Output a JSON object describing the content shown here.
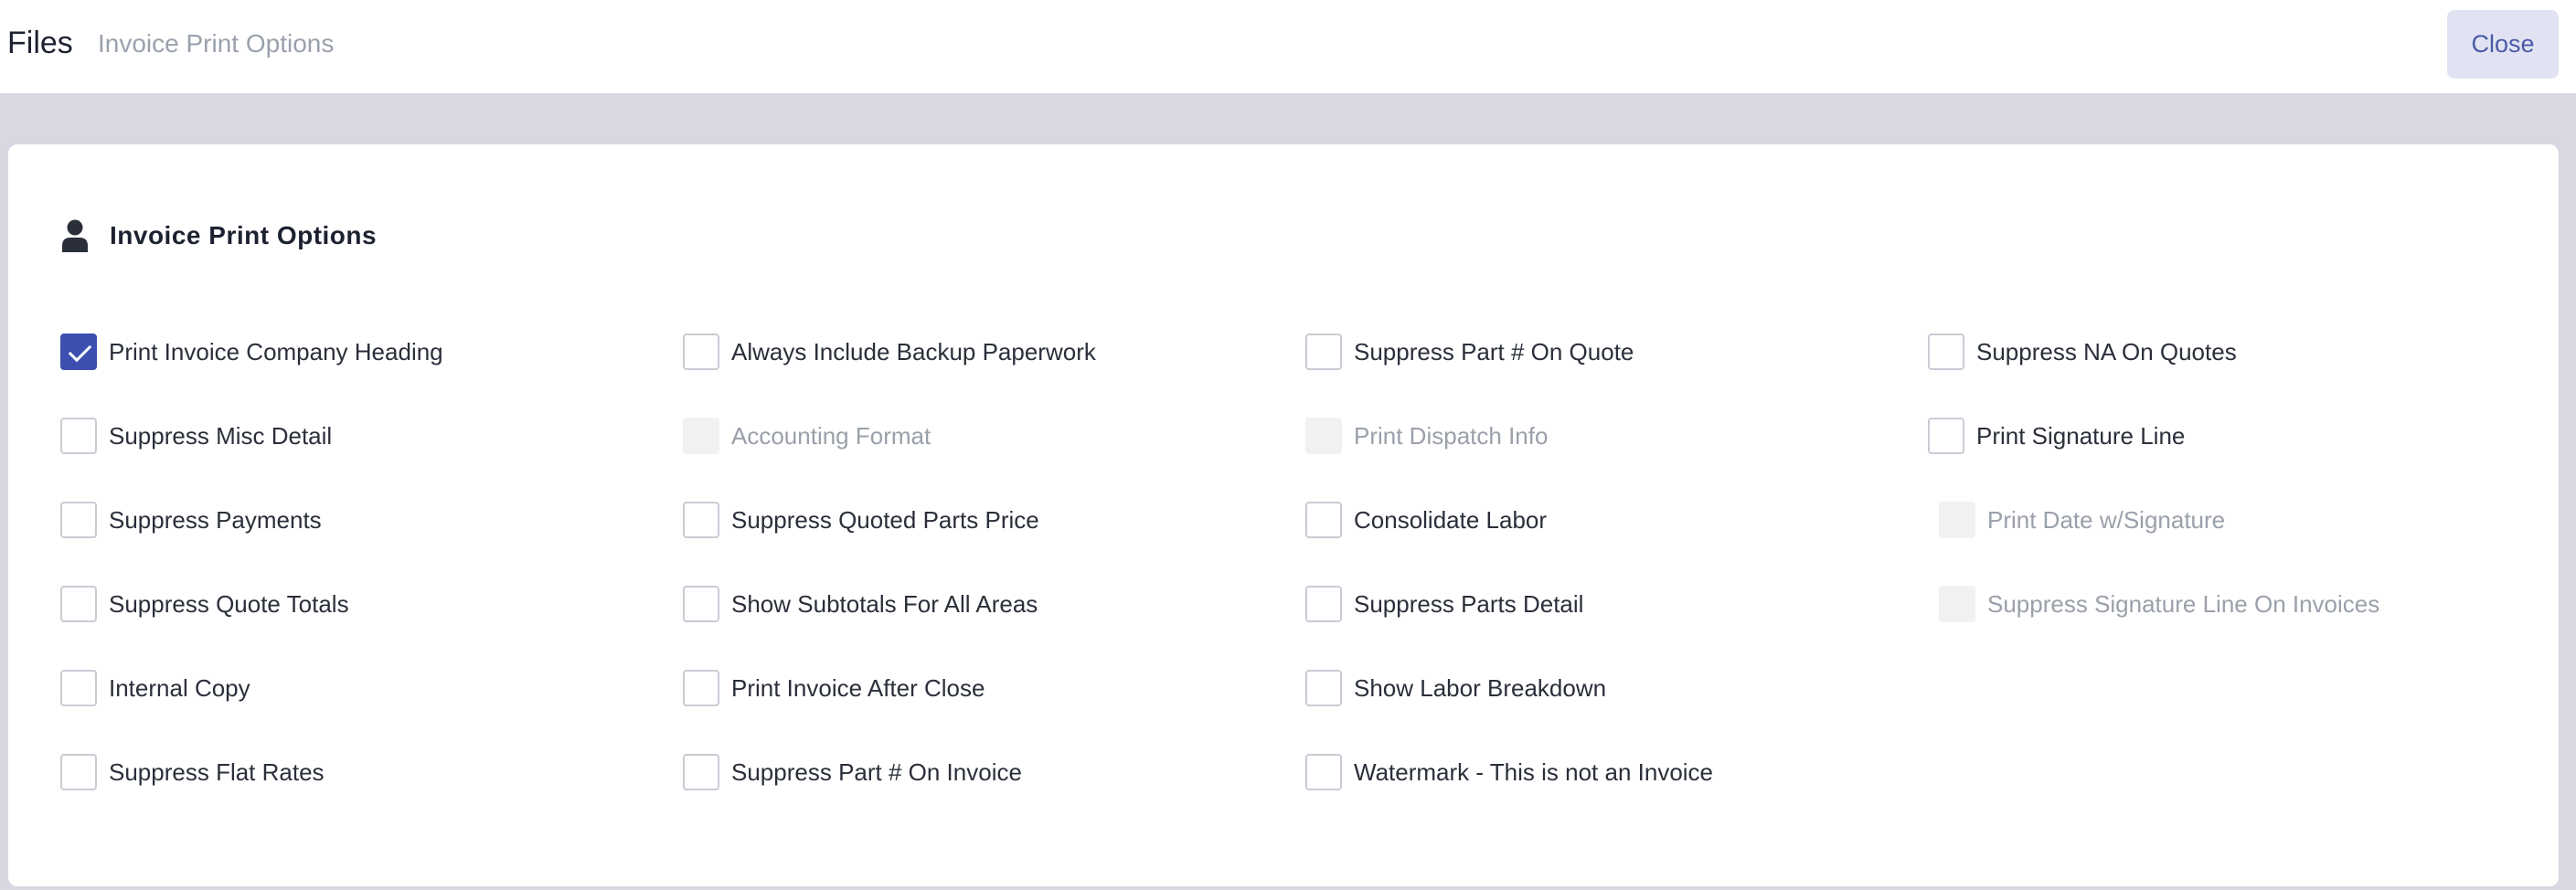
{
  "header": {
    "title": "Files",
    "breadcrumb": "Invoice Print Options",
    "close_label": "Close"
  },
  "section": {
    "title": "Invoice Print Options",
    "icon": "user-icon"
  },
  "colors": {
    "accent": "#3c4fb0",
    "background_band": "#d8d8e2",
    "close_button_bg": "#e1e3f3"
  },
  "options": {
    "col1": [
      {
        "label": "Print Invoice Company Heading",
        "checked": true,
        "disabled": false
      },
      {
        "label": "Suppress Misc Detail",
        "checked": false,
        "disabled": false
      },
      {
        "label": "Suppress Payments",
        "checked": false,
        "disabled": false
      },
      {
        "label": "Suppress Quote Totals",
        "checked": false,
        "disabled": false
      },
      {
        "label": "Internal Copy",
        "checked": false,
        "disabled": false
      },
      {
        "label": "Suppress Flat Rates",
        "checked": false,
        "disabled": false
      }
    ],
    "col2": [
      {
        "label": "Always Include Backup Paperwork",
        "checked": false,
        "disabled": false
      },
      {
        "label": "Accounting Format",
        "checked": false,
        "disabled": true
      },
      {
        "label": "Suppress Quoted Parts Price",
        "checked": false,
        "disabled": false
      },
      {
        "label": "Show Subtotals For All Areas",
        "checked": false,
        "disabled": false
      },
      {
        "label": "Print Invoice After Close",
        "checked": false,
        "disabled": false
      },
      {
        "label": "Suppress Part # On Invoice",
        "checked": false,
        "disabled": false
      }
    ],
    "col3": [
      {
        "label": "Suppress Part # On Quote",
        "checked": false,
        "disabled": false
      },
      {
        "label": "Print Dispatch Info",
        "checked": false,
        "disabled": true
      },
      {
        "label": "Consolidate Labor",
        "checked": false,
        "disabled": false
      },
      {
        "label": "Suppress Parts Detail",
        "checked": false,
        "disabled": false
      },
      {
        "label": "Show Labor Breakdown",
        "checked": false,
        "disabled": false
      },
      {
        "label": "Watermark - This is not an Invoice",
        "checked": false,
        "disabled": false
      }
    ],
    "col4": [
      {
        "label": "Suppress NA On Quotes",
        "checked": false,
        "disabled": false
      },
      {
        "label": "Print Signature Line",
        "checked": false,
        "disabled": false
      },
      {
        "label": "Print Date w/Signature",
        "checked": false,
        "disabled": true
      },
      {
        "label": "Suppress Signature Line On Invoices",
        "checked": false,
        "disabled": true
      }
    ]
  }
}
